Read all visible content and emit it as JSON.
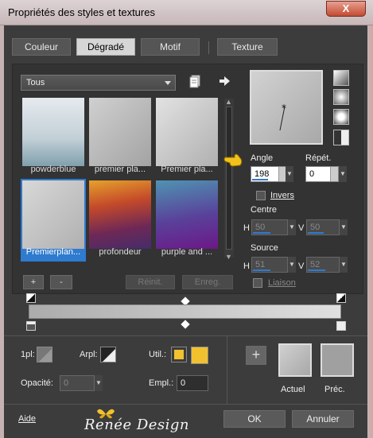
{
  "window": {
    "title": "Propriétés des styles et textures",
    "close_glyph": "X"
  },
  "tabs": [
    {
      "label": "Couleur"
    },
    {
      "label": "Dégradé",
      "active": true
    },
    {
      "label": "Motif"
    },
    {
      "label": "Texture"
    }
  ],
  "gradient_library": {
    "filter_value": "Tous",
    "tiles": [
      {
        "label": "powderblue",
        "colors": [
          "#dfe5eb",
          "#b4c6cf",
          "#8aa7b3"
        ]
      },
      {
        "label": "premier pla...",
        "colors": [
          "#c9c9c9",
          "#a8a8a8"
        ]
      },
      {
        "label": "Premier pla...",
        "colors": [
          "#d9d9d9",
          "#b2b2b2"
        ]
      },
      {
        "label": "Premierplan...",
        "colors": [
          "#d2d2d2",
          "#b5b5b5"
        ],
        "selected": true
      },
      {
        "label": "profondeur",
        "colors": [
          "#e39a2e",
          "#b4342c",
          "#6a2b5a",
          "#4b2e6e"
        ]
      },
      {
        "label": "purple and ...",
        "colors": [
          "#4f8fb0",
          "#5a3b91",
          "#6b1a86"
        ]
      }
    ],
    "add_label": "+",
    "remove_label": "-",
    "reset_label": "Réinit.",
    "save_label": "Enreg."
  },
  "settings": {
    "angle_label": "Angle",
    "angle_value": "198",
    "repeat_label": "Répét.",
    "repeat_value": "0",
    "invert_label": "Invers",
    "center_label": "Centre",
    "center_h": "50",
    "center_v": "50",
    "source_label": "Source",
    "source_h": "51",
    "source_v": "52",
    "link_label": "Liaison",
    "h_label": "H",
    "v_label": "V"
  },
  "stops": {
    "first_label": "1pl:",
    "bg_label": "Arpl:",
    "use_label": "Util.:",
    "opacity_label": "Opacité:",
    "opacity_value": "0",
    "location_label": "Empl.:",
    "location_value": "0",
    "use_color_1": "#f2c12e",
    "use_color_2": "#f2c12e"
  },
  "current_previous": {
    "current_label": "Actuel",
    "previous_label": "Préc.",
    "add_glyph": "+"
  },
  "footer": {
    "help_label": "Aide",
    "ok_label": "OK",
    "cancel_label": "Annuler",
    "watermark": "Renée Design"
  }
}
